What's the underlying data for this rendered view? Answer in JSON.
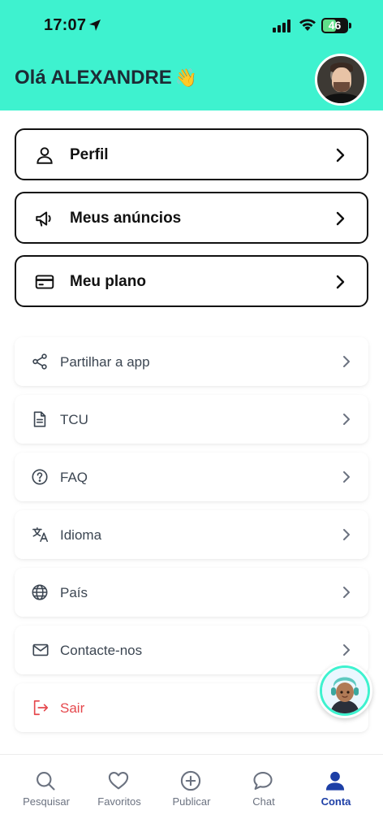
{
  "status_bar": {
    "time": "17:07",
    "battery": "46"
  },
  "header": {
    "greeting": "Olá ALEXANDRE",
    "wave_emoji": "👋"
  },
  "primary_menu": [
    {
      "label": "Perfil",
      "icon": "user-icon"
    },
    {
      "label": "Meus anúncios",
      "icon": "megaphone-icon"
    },
    {
      "label": "Meu plano",
      "icon": "credit-card-icon"
    }
  ],
  "secondary_menu": [
    {
      "label": "Partilhar a app",
      "icon": "share-icon"
    },
    {
      "label": "TCU",
      "icon": "document-icon"
    },
    {
      "label": "FAQ",
      "icon": "question-circle-icon"
    },
    {
      "label": "Idioma",
      "icon": "translate-icon"
    },
    {
      "label": "País",
      "icon": "globe-icon"
    },
    {
      "label": "Contacte-nos",
      "icon": "mail-icon"
    },
    {
      "label": "Sair",
      "icon": "logout-icon"
    }
  ],
  "tabbar": [
    {
      "label": "Pesquisar",
      "icon": "search-icon"
    },
    {
      "label": "Favoritos",
      "icon": "heart-icon"
    },
    {
      "label": "Publicar",
      "icon": "plus-circle-icon"
    },
    {
      "label": "Chat",
      "icon": "chat-icon"
    },
    {
      "label": "Conta",
      "icon": "person-icon",
      "active": true
    }
  ],
  "colors": {
    "accent": "#3ef2cf",
    "active_tab": "#1d3fa6",
    "danger": "#e5484d",
    "text": "#3c4652"
  }
}
